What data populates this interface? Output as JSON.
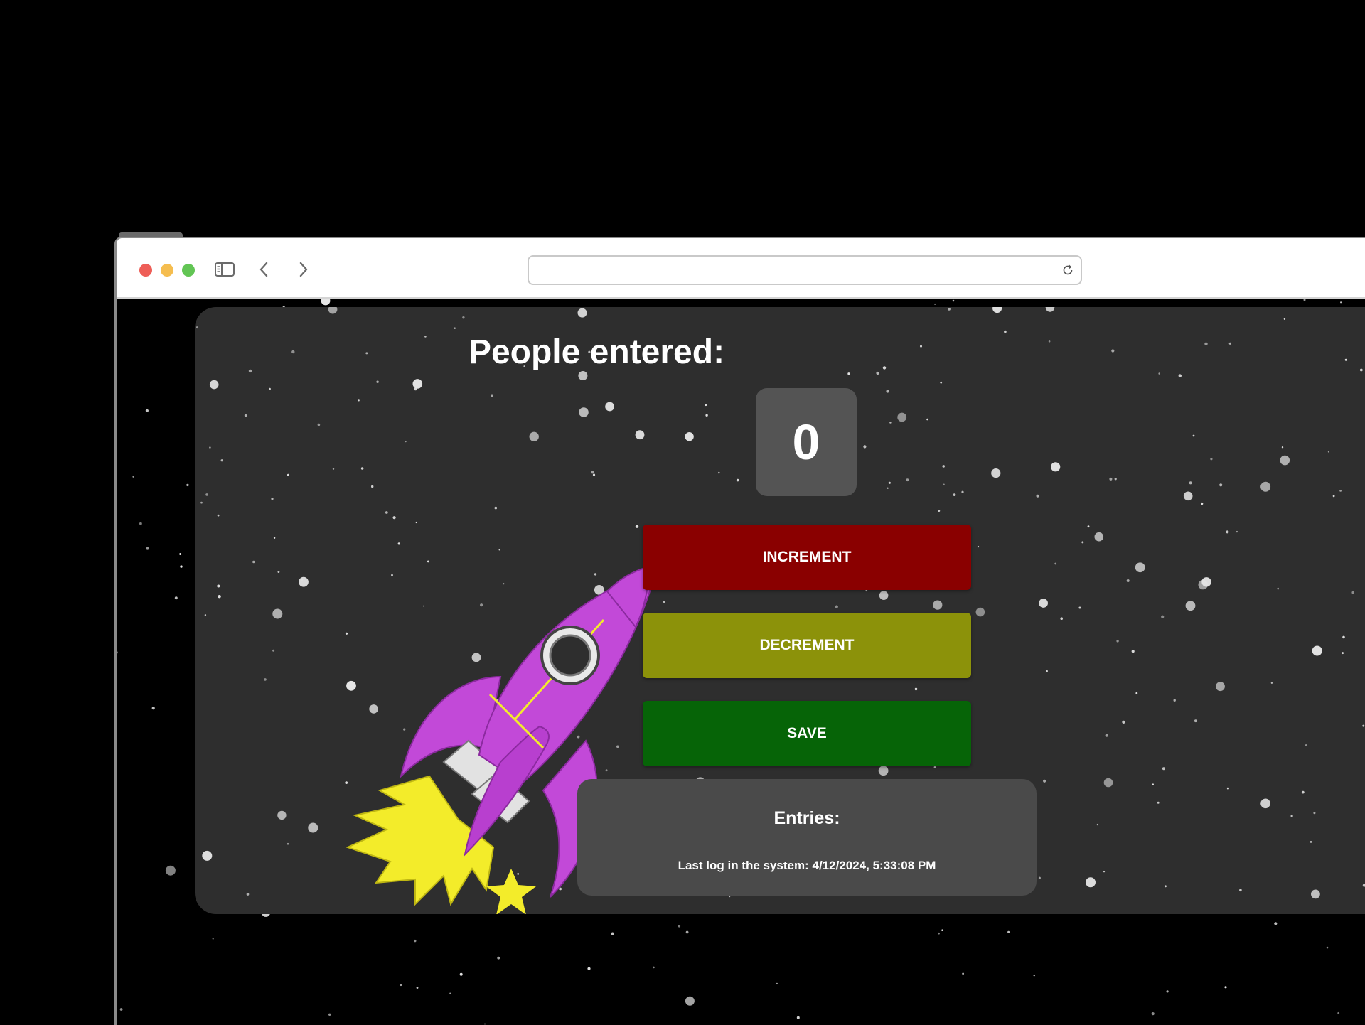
{
  "browser": {
    "url": "",
    "icons": [
      "sidebar-toggle-icon",
      "back-chevron-icon",
      "forward-chevron-icon",
      "reload-icon"
    ]
  },
  "app": {
    "title": "People entered:",
    "count": "0",
    "buttons": {
      "increment": "INCREMENT",
      "decrement": "DECREMENT",
      "save": "SAVE"
    },
    "entries": {
      "title": "Entries:",
      "log": "Last log in the system: 4/12/2024, 5:33:08 PM"
    }
  },
  "colors": {
    "increment": "#8a0000",
    "decrement": "#8c920a",
    "save": "#066407",
    "card": "#2e2e2e",
    "rocket": "#c249d8",
    "flame": "#f3ec2a"
  }
}
